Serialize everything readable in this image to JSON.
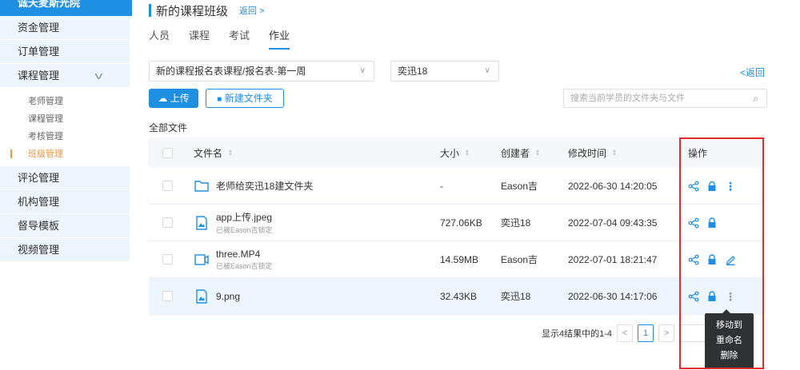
{
  "sidebar": {
    "brand": "诚天麦斯光院",
    "items": [
      {
        "label": "资金管理"
      },
      {
        "label": "订单管理"
      },
      {
        "label": "课程管理"
      }
    ],
    "sub_items": [
      {
        "label": "老师管理"
      },
      {
        "label": "课程管理"
      },
      {
        "label": "考核管理"
      },
      {
        "label": "班级管理",
        "active": true
      }
    ],
    "items_after": [
      {
        "label": "评论管理"
      },
      {
        "label": "机构管理"
      },
      {
        "label": "督导模板"
      },
      {
        "label": "视频管理"
      }
    ]
  },
  "header": {
    "title": "新的课程班级",
    "back": "返回 >"
  },
  "tabs": [
    {
      "label": "人员"
    },
    {
      "label": "课程"
    },
    {
      "label": "考试"
    },
    {
      "label": "作业",
      "active": true
    }
  ],
  "filters": {
    "course_select": "新的课程报名表课程/报名表-第一周",
    "student_select": "奕迅18",
    "back_right": "<返回"
  },
  "toolbar": {
    "upload_label": "上传",
    "new_folder_label": "新建文件夹",
    "search_placeholder": "搜索当前学员的文件夹与文件"
  },
  "section_title": "全部文件",
  "table": {
    "columns": {
      "name": "文件名",
      "size": "大小",
      "creator": "创建者",
      "modified": "修改时间",
      "actions": "操作"
    },
    "rows": [
      {
        "name": "老师给奕迅18建文件夹",
        "sub": "",
        "type": "folder",
        "size": "-",
        "creator": "Eason吉",
        "modified": "2022-06-30 14:20:05",
        "ops": [
          "share",
          "lock",
          "more"
        ]
      },
      {
        "name": "app上传.jpeg",
        "sub": "已被Eason吉锁定",
        "type": "image",
        "size": "727.06KB",
        "creator": "奕迅18",
        "modified": "2022-07-04 09:43:35",
        "ops": [
          "share",
          "lock"
        ]
      },
      {
        "name": "three.MP4",
        "sub": "已被Eason吉锁定",
        "type": "video",
        "size": "14.59MB",
        "creator": "Eason吉",
        "modified": "2022-07-01 18:21:47",
        "ops": [
          "share",
          "lock",
          "edit"
        ]
      },
      {
        "name": "9.png",
        "sub": "",
        "type": "image",
        "size": "32.43KB",
        "creator": "奕迅18",
        "modified": "2022-06-30 14:17:06",
        "ops": [
          "share",
          "lock",
          "more"
        ],
        "hover": true
      }
    ]
  },
  "pagination": {
    "summary": "显示4结果中的1-4",
    "current_page": "1"
  },
  "dropdown": {
    "items": [
      "移动到",
      "重命名",
      "删除"
    ]
  },
  "colors": {
    "primary": "#1e8fe3",
    "accent": "#f0923e",
    "highlight": "#e42a2a"
  }
}
